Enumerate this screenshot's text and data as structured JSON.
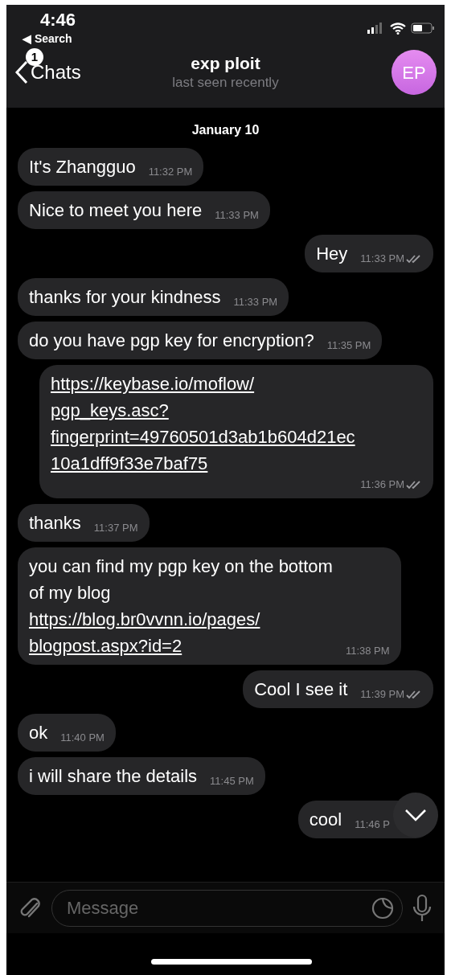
{
  "status_bar": {
    "time": "4:46",
    "back_label": "◀ Search"
  },
  "header": {
    "back": "Chats",
    "unread": "1",
    "title": "exp ploit",
    "subtitle": "last seen recently",
    "avatar": "EP"
  },
  "date": "January 10",
  "messages": [
    {
      "kind": "incoming",
      "text": "It's Zhangguo",
      "time": "11:32 PM"
    },
    {
      "kind": "incoming",
      "text": "Nice to meet you here",
      "time": "11:33 PM"
    },
    {
      "kind": "outgoing",
      "text": "Hey",
      "time": "11:33 PM",
      "read": true
    },
    {
      "kind": "incoming",
      "text": "thanks for your kindness",
      "time": "11:33 PM"
    },
    {
      "kind": "incoming",
      "text": "do you have pgp key for encryption?",
      "time": "11:35 PM"
    },
    {
      "kind": "outgoing",
      "link": "https://keybase.io/moflow/\npgp_keys.asc?\nfingerprint=49760501d3ab1b604d21ec\n10a1dff9f33e7baf75",
      "time": "11:36 PM",
      "read": true
    },
    {
      "kind": "incoming",
      "text": "thanks",
      "time": "11:37 PM"
    },
    {
      "kind": "incoming",
      "text": "you can find my pgp key on the bottom\nof my blog",
      "link": "https://blog.br0vvnn.io/pages/\nblogpost.aspx?id=2",
      "time": "11:38 PM"
    },
    {
      "kind": "outgoing",
      "text": "Cool I see it",
      "time": "11:39 PM",
      "read": true
    },
    {
      "kind": "incoming",
      "text": "ok",
      "time": "11:40 PM"
    },
    {
      "kind": "incoming",
      "text": "i will share the details",
      "time": "11:45 PM"
    },
    {
      "kind": "outgoing",
      "text": "cool",
      "time": "11:46 P"
    }
  ],
  "composer": {
    "placeholder": "Message"
  }
}
